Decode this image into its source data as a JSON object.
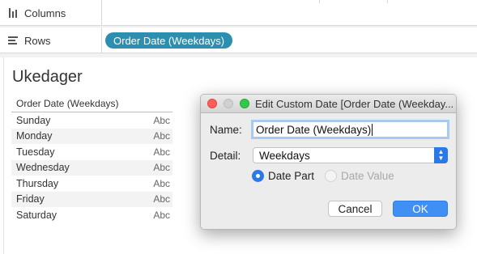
{
  "shelves": {
    "columns": {
      "label": "Columns"
    },
    "rows": {
      "label": "Rows",
      "pill": "Order Date (Weekdays)"
    }
  },
  "sheet": {
    "title": "Ukedager",
    "header": "Order Date (Weekdays)",
    "rows": [
      {
        "day": "Sunday",
        "value": "Abc"
      },
      {
        "day": "Monday",
        "value": "Abc"
      },
      {
        "day": "Tuesday",
        "value": "Abc"
      },
      {
        "day": "Wednesday",
        "value": "Abc"
      },
      {
        "day": "Thursday",
        "value": "Abc"
      },
      {
        "day": "Friday",
        "value": "Abc"
      },
      {
        "day": "Saturday",
        "value": "Abc"
      }
    ]
  },
  "dialog": {
    "title": "Edit Custom Date [Order Date (Weekday...",
    "name_label": "Name:",
    "name_value": "Order Date (Weekdays)",
    "detail_label": "Detail:",
    "detail_value": "Weekdays",
    "radio_date_part": "Date Part",
    "radio_date_value": "Date Value",
    "radio_selected": "Date Part",
    "cancel_label": "Cancel",
    "ok_label": "OK"
  },
  "colors": {
    "pill": "#2c8fb0",
    "accent": "#2a78ea",
    "close": "#fc5f57",
    "zoom": "#34c84a"
  }
}
